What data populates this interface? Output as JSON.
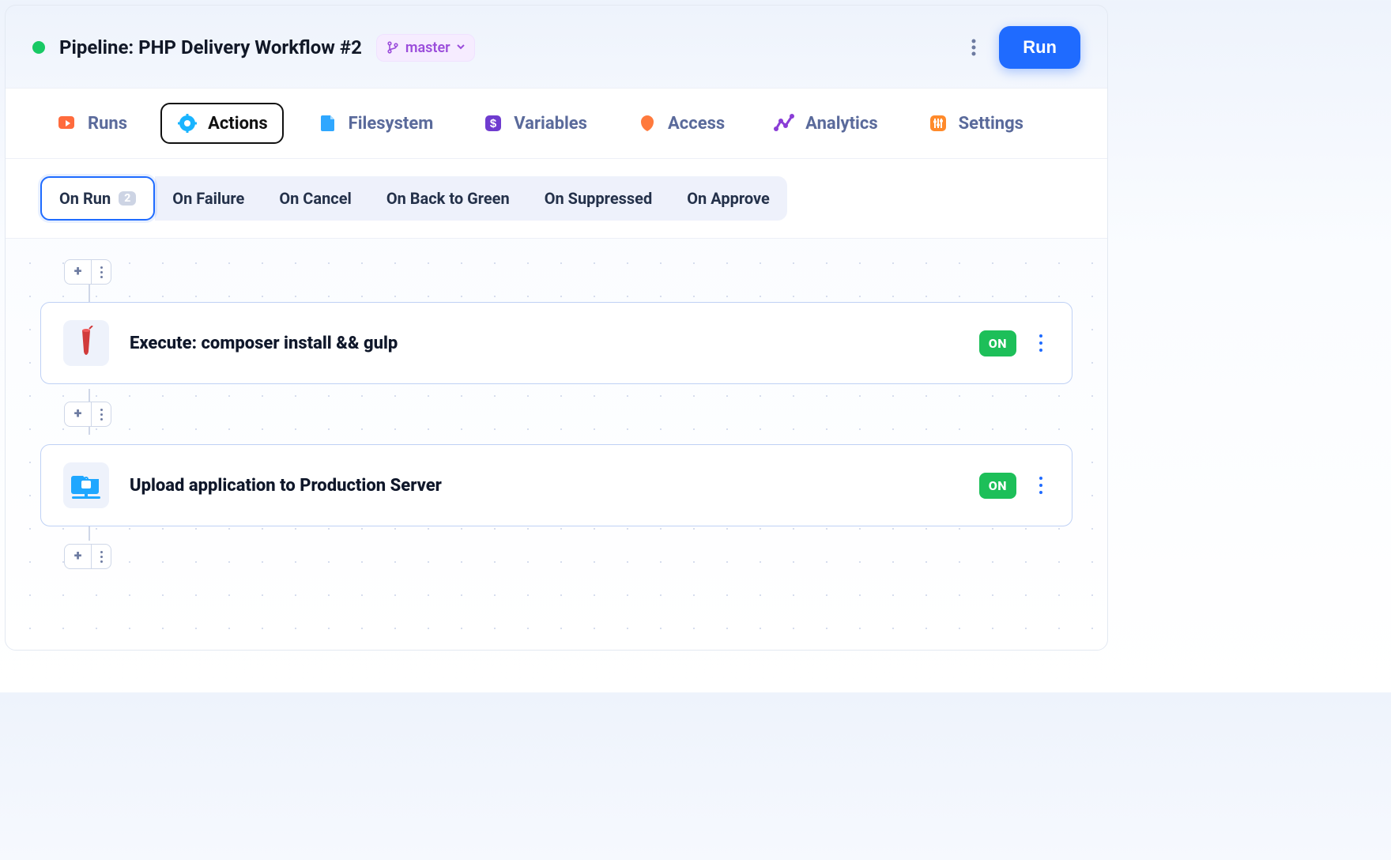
{
  "header": {
    "title": "Pipeline: PHP Delivery Workflow #2",
    "branch": "master",
    "run_label": "Run"
  },
  "nav": {
    "tabs": [
      {
        "label": "Runs",
        "icon": "runs"
      },
      {
        "label": "Actions",
        "icon": "actions",
        "active": true
      },
      {
        "label": "Filesystem",
        "icon": "filesystem"
      },
      {
        "label": "Variables",
        "icon": "variables"
      },
      {
        "label": "Access",
        "icon": "access"
      },
      {
        "label": "Analytics",
        "icon": "analytics"
      },
      {
        "label": "Settings",
        "icon": "settings"
      }
    ]
  },
  "subnav": {
    "tabs": [
      {
        "label": "On Run",
        "count": "2",
        "active": true
      },
      {
        "label": "On Failure"
      },
      {
        "label": "On Cancel"
      },
      {
        "label": "On Back to Green"
      },
      {
        "label": "On Suppressed"
      },
      {
        "label": "On Approve"
      }
    ]
  },
  "actions": [
    {
      "title": "Execute: composer install && gulp",
      "state": "ON",
      "icon": "gulp"
    },
    {
      "title": "Upload application to Production Server",
      "state": "ON",
      "icon": "sftp"
    }
  ],
  "colors": {
    "accent": "#1f6bff",
    "success": "#18c964",
    "purple": "#9b4ddb"
  }
}
